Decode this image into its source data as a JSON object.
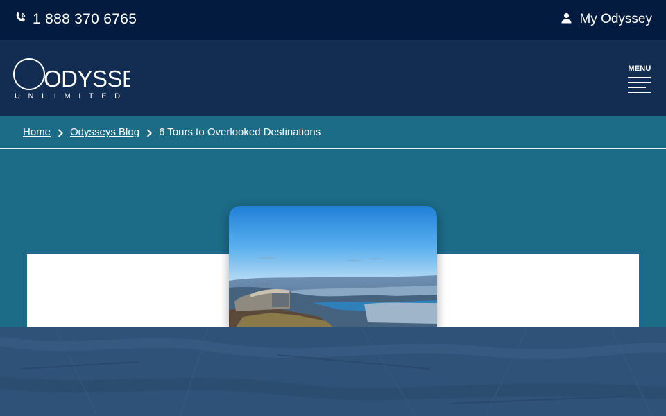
{
  "topbar": {
    "phone_number": "1 888 370 6765",
    "phone_icon": "phone-icon",
    "account_label": "My Odyssey",
    "account_icon": "user-icon"
  },
  "header": {
    "logo_main": "ODYSSEYS",
    "logo_sub": "UNLIMITED",
    "menu_label": "MENU"
  },
  "breadcrumb": {
    "items": [
      {
        "label": "Home",
        "link": true
      },
      {
        "label": "Odysseys Blog",
        "link": true
      },
      {
        "label": "6 Tours to Overlooked Destinations",
        "link": false
      }
    ],
    "separator_icon": "chevron-right-icon"
  },
  "colors": {
    "topbar": "#031b3e",
    "header": "#122c52",
    "teal": "#1c6b87",
    "footer_texture": "#2f5279"
  }
}
